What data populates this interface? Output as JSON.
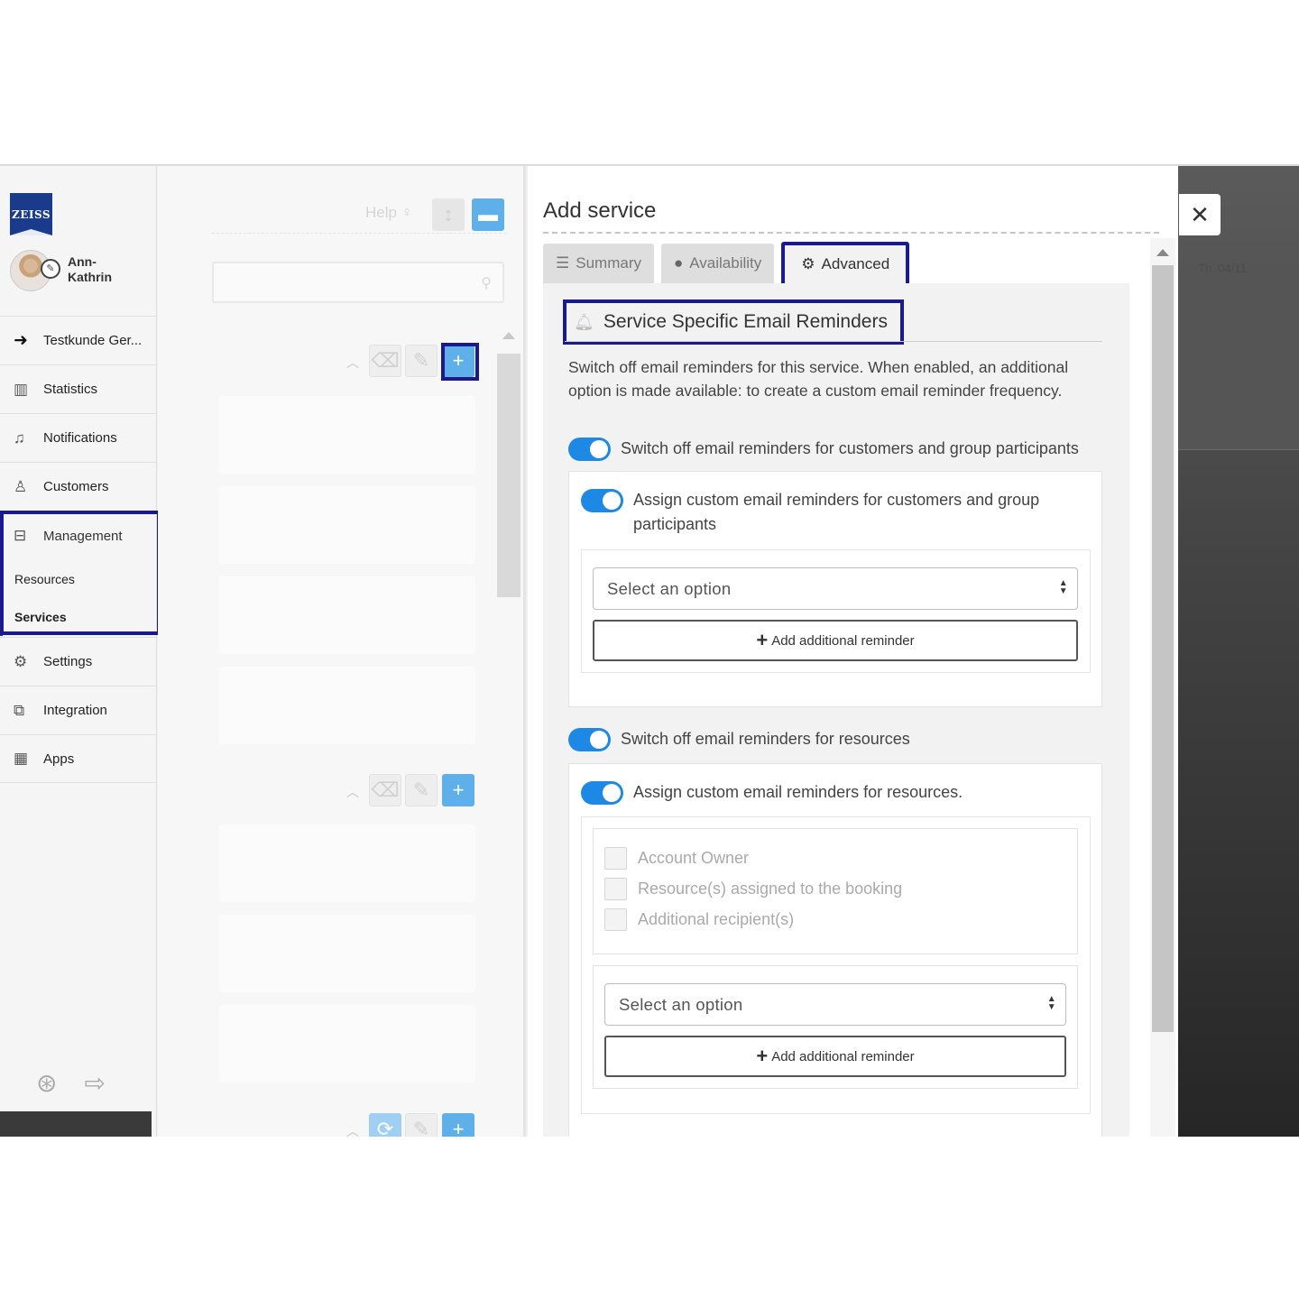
{
  "sidebar": {
    "logo_text": "ZEISS",
    "user_name": "Ann-\nKathrin",
    "items": [
      {
        "label": "Testkunde Ger...",
        "icon": "arrow-left-circle-icon"
      },
      {
        "label": "Statistics",
        "icon": "bar-chart-icon"
      },
      {
        "label": "Notifications",
        "icon": "bell-icon"
      },
      {
        "label": "Customers",
        "icon": "user-icon"
      }
    ],
    "management": {
      "label": "Management",
      "sub_items": [
        "Resources",
        "Services"
      ],
      "active": "Services"
    },
    "items_after": [
      {
        "label": "Settings",
        "icon": "gears-icon"
      },
      {
        "label": "Integration",
        "icon": "puzzle-icon"
      },
      {
        "label": "Apps",
        "icon": "grid-icon"
      }
    ]
  },
  "middle": {
    "help_label": "Help"
  },
  "panel": {
    "title": "Add service",
    "tabs": [
      {
        "label": "Summary",
        "icon": "list-icon"
      },
      {
        "label": "Availability",
        "icon": "clock-icon"
      },
      {
        "label": "Advanced",
        "icon": "gears-icon",
        "active": true
      }
    ],
    "section_title": "Service Specific Email Reminders",
    "description": "Switch off email reminders for this service. When enabled, an additional option is made available: to create a custom email reminder frequency.",
    "customers": {
      "switch_off_label": "Switch off email reminders for customers and group participants",
      "switch_off_on": true,
      "custom_label": "Assign custom email reminders for customers and group participants",
      "custom_on": true,
      "select_placeholder": "Select an option",
      "add_button": "Add additional reminder"
    },
    "resources": {
      "switch_off_label": "Switch off email reminders for resources",
      "switch_off_on": true,
      "custom_label": "Assign custom email reminders for resources.",
      "custom_on": true,
      "recipients": [
        {
          "label": "Account Owner",
          "checked": false
        },
        {
          "label": "Resource(s) assigned to the booking",
          "checked": false
        },
        {
          "label": "Additional recipient(s)",
          "checked": false
        }
      ],
      "select_placeholder": "Select an option",
      "add_button": "Add additional reminder"
    }
  },
  "overlay": {
    "date_label": "Th. 04/11"
  },
  "colors": {
    "accent": "#1e88e5",
    "highlight": "#1a1a8c",
    "brand": "#1a3a8c"
  }
}
